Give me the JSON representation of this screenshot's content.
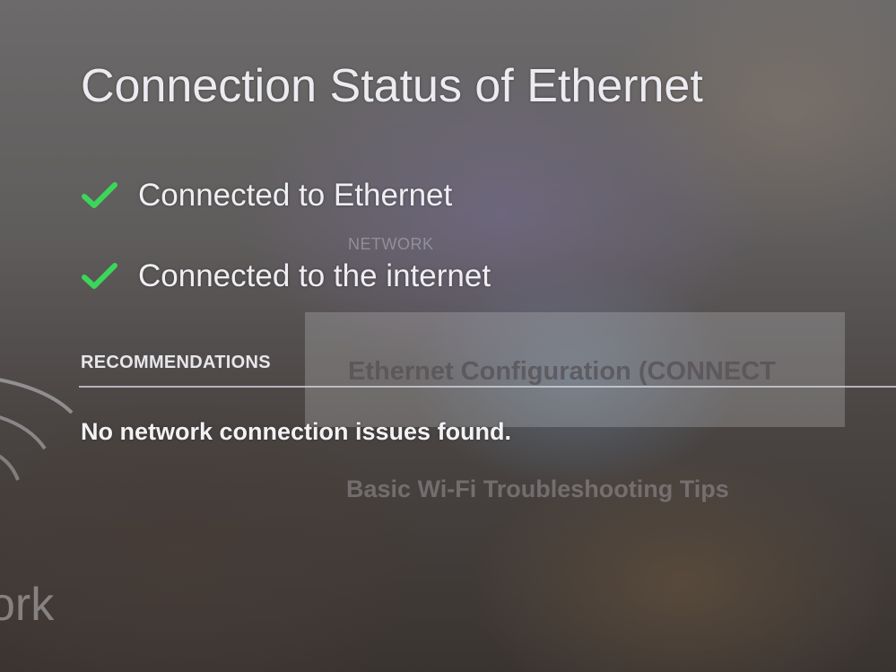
{
  "background_menu": {
    "section_header": "NETWORK",
    "items": [
      {
        "label": "Ethernet Configuration (CONNECT"
      },
      {
        "label": "Basic Wi-Fi Troubleshooting Tips"
      }
    ],
    "side_label": "ork"
  },
  "dialog": {
    "title": "Connection Status of Ethernet",
    "statuses": [
      {
        "icon": "check-icon",
        "label": "Connected to Ethernet"
      },
      {
        "icon": "check-icon",
        "label": "Connected to the internet"
      }
    ],
    "recommendations": {
      "header": "RECOMMENDATIONS",
      "message": "No network connection issues found."
    }
  },
  "colors": {
    "check": "#3cd65a",
    "text": "#efeef3"
  }
}
